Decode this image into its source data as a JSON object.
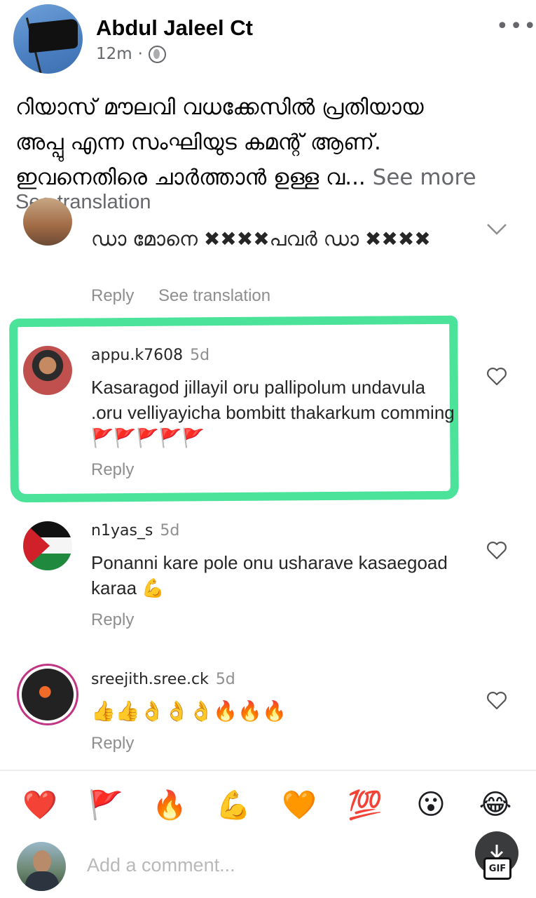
{
  "post": {
    "author": "Abdul Jaleel Ct",
    "time": "12m",
    "separator": "·",
    "text_line1": "റിയാസ് മൗലവി വധക്കേസിൽ പ്രതിയായ",
    "text_line2": "അപ്പു എന്ന സംഘിയുട കമന്റ് ആണ്.",
    "text_line3": "ഇവനെതിരെ ചാർത്താൻ ഉള്ള വ...",
    "see_more": "See more",
    "see_translation": "See translation"
  },
  "comments": [
    {
      "username": "",
      "age": "",
      "text": "ഡാ മോനെ ✖✖✖✖പവർ ഡാ ✖✖✖✖",
      "reply": "Reply",
      "see_translation": "See translation"
    },
    {
      "username": "appu.k7608",
      "age": "5d",
      "text": "Kasaragod jillayil oru pallipolum undavula .oru velliyayicha bombitt thakarkum comming 🚩🚩🚩🚩🚩",
      "reply": "Reply"
    },
    {
      "username": "n1yas_s",
      "age": "5d",
      "text": "Ponanni kare pole onu usharave kasaegoad karaa 💪",
      "reply": "Reply"
    },
    {
      "username": "sreejith.sree.ck",
      "age": "5d",
      "text": "👍👍👌👌👌🔥🔥🔥",
      "reply": "Reply"
    }
  ],
  "emoji_bar": [
    "❤️",
    "🚩",
    "🔥",
    "💪",
    "🧡",
    "💯",
    "😮",
    "😂"
  ],
  "add_comment_placeholder": "Add a comment...",
  "gif_label": "GIF",
  "colors": {
    "highlight": "#4be39a",
    "secondary_text": "#65676b"
  }
}
